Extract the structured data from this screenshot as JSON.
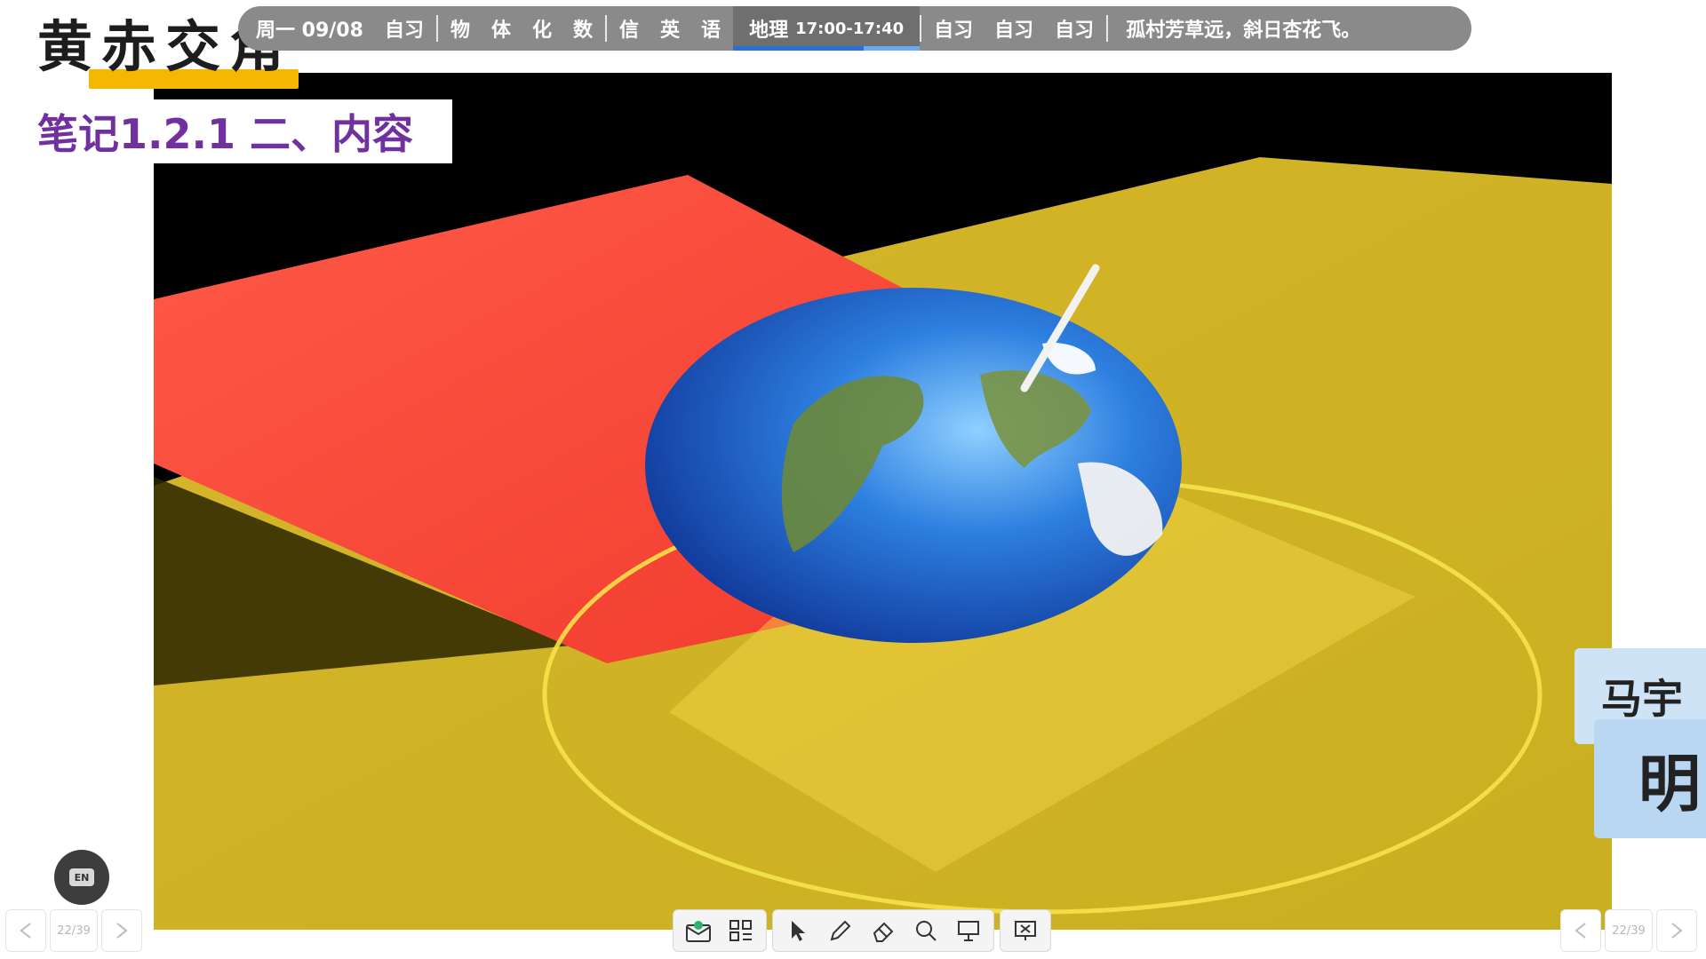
{
  "slide": {
    "title": "黄赤交角",
    "section_label": "笔记1.2.1 二、内容"
  },
  "schedule": {
    "day_date": "周一 09/08",
    "items_before": [
      "自习",
      "物",
      "体",
      "化",
      "数",
      "信",
      "英",
      "语"
    ],
    "current_subject": "地理",
    "current_time": "17:00-17:40",
    "items_after": [
      "自习",
      "自习",
      "自习"
    ],
    "poem": "孤村芳草远，斜日杏花飞。",
    "current_progress": 0.7
  },
  "video": {
    "content": "Earth globe intersecting red ecliptic plane and yellow equatorial plane"
  },
  "name_cards": {
    "top": "马宇",
    "bottom": "明"
  },
  "language_button": {
    "label": "EN"
  },
  "page_nav": {
    "current": "22/39"
  },
  "toolbar": {
    "tools": [
      "whiteboard-icon",
      "apps-grid-icon",
      "pointer-icon",
      "pen-icon",
      "eraser-icon",
      "zoom-icon",
      "present-icon",
      "exit-icon"
    ]
  },
  "colors": {
    "section_label": "#7030a0",
    "title_underline": "#f5b800",
    "schedule_bar": "#8a8a8a",
    "progress": "#6aaaf0"
  }
}
